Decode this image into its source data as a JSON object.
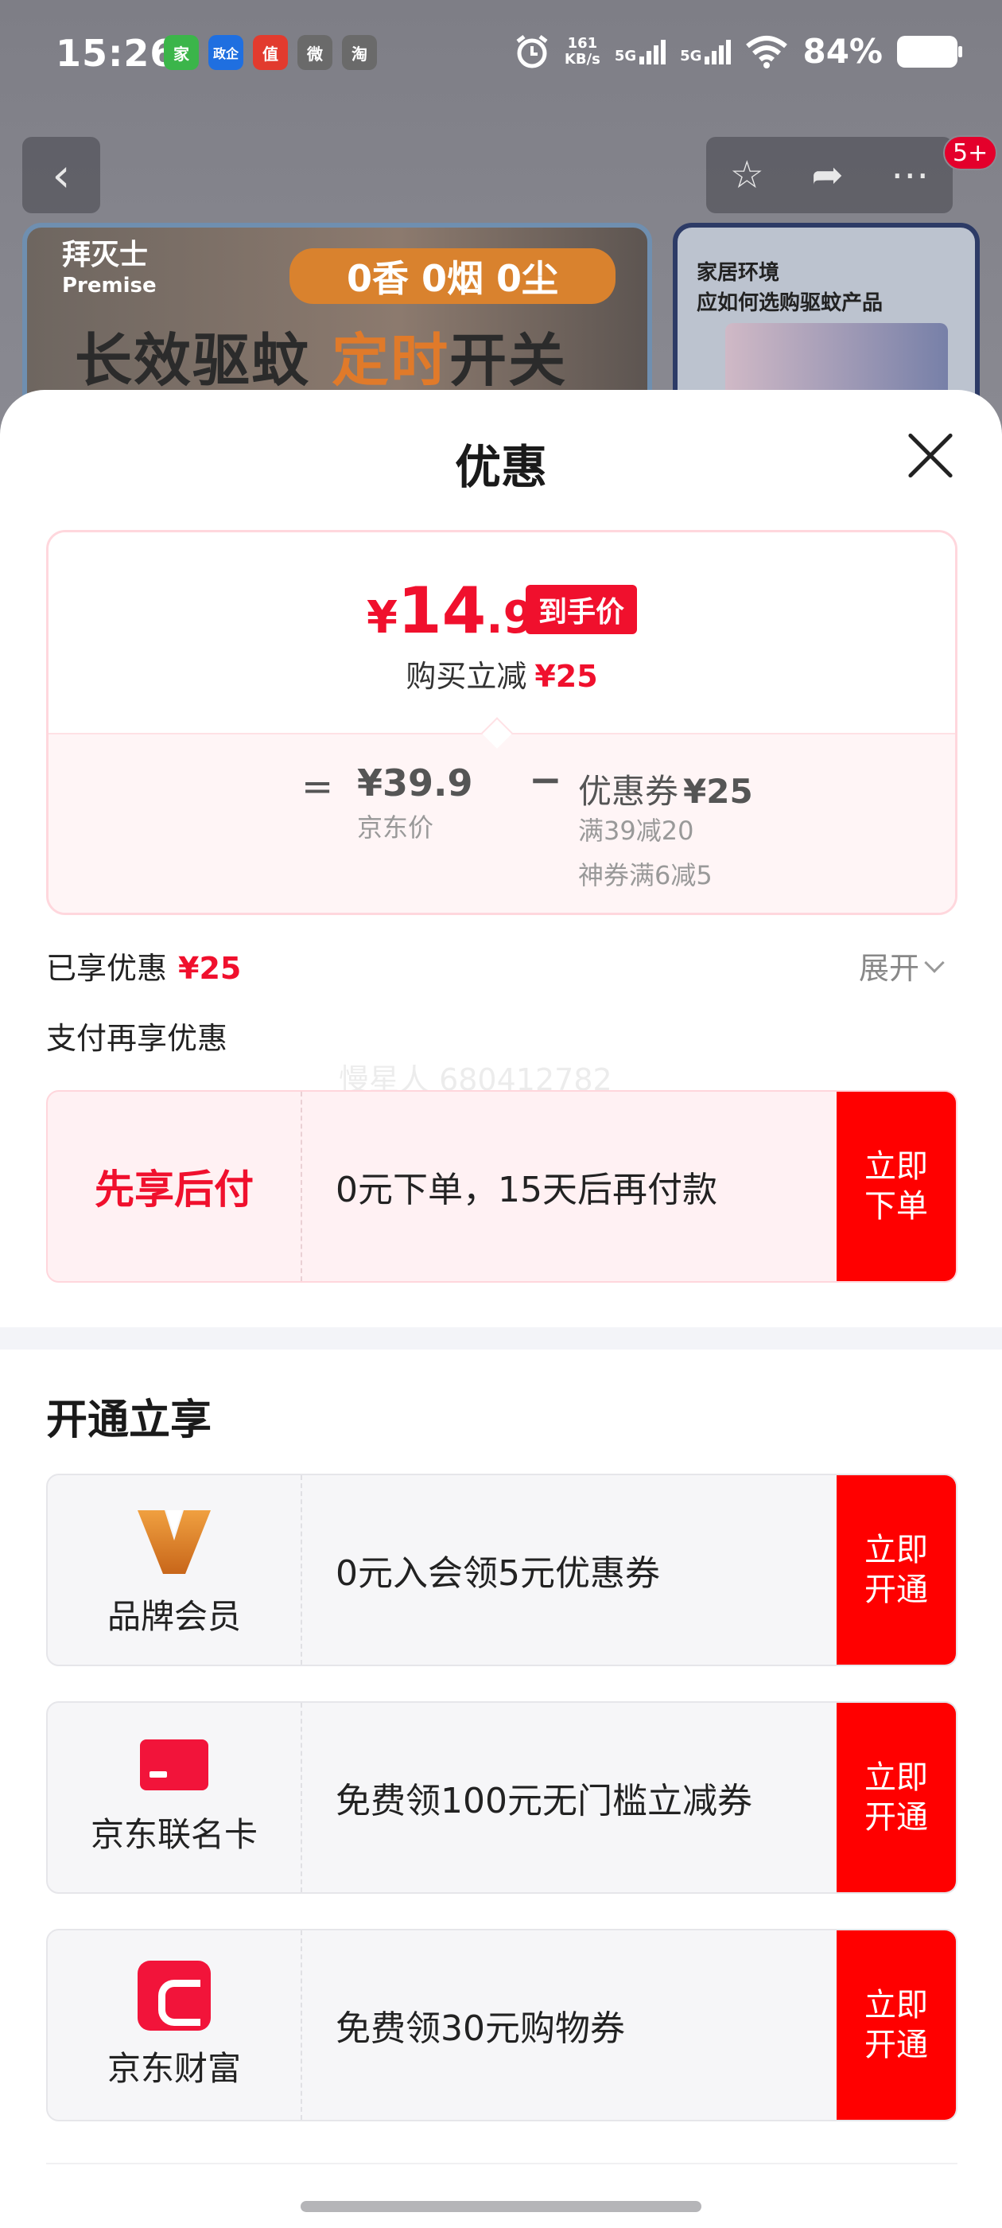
{
  "status_bar": {
    "time": "15:26",
    "apps": [
      "家",
      "政企",
      "值",
      "微",
      "淘"
    ],
    "net_speed": "161",
    "net_unit": "KB/s",
    "sig1": "5G",
    "sig2": "5G",
    "battery": "84%"
  },
  "background": {
    "banner_brand": "拜灭士",
    "banner_brand_sub": "Premise",
    "banner_pill": "0香 0烟 0尘",
    "banner_title_a": "长效驱蚊",
    "banner_title_b": "定时",
    "banner_title_c": "开关",
    "side_card_title_1": "家居环境",
    "side_card_title_2": "应如何选购驱蚊产品",
    "cart_badge": "5+"
  },
  "sheet": {
    "title": "优惠",
    "final_price": {
      "yen": "¥",
      "int": "14",
      "dec": ".9",
      "tag": "到手价"
    },
    "reduce_label": "购买立减",
    "reduce_value": "¥25",
    "calc": {
      "eq": "=",
      "jd_price": "¥39.9",
      "jd_label": "京东价",
      "minus": "−",
      "coupon_label": "优惠券",
      "coupon_value": "¥25",
      "coupon_rule_1": "满39减20",
      "coupon_rule_2": "神券满6减5"
    },
    "enjoyed_label": "已享优惠",
    "enjoyed_value": "¥25",
    "expand_label": "展开",
    "pay_more_label": "支付再享优惠",
    "watermark": "慢星人 680412782",
    "pay_offer": {
      "name": "先享后付",
      "desc": "0元下单，15天后再付款",
      "button": "立即下单"
    },
    "open_section_title": "开通立享",
    "open_offers": [
      {
        "name": "品牌会员",
        "desc": "0元入会领5元优惠券",
        "button": "立即开通"
      },
      {
        "name": "京东联名卡",
        "desc": "免费领100元无门槛立减券",
        "button": "立即开通"
      },
      {
        "name": "京东财富",
        "desc": "免费领30元购物券",
        "button": "立即开通"
      }
    ]
  },
  "colors": {
    "accent_red": "#f0102d",
    "button_red": "#ff0000"
  }
}
